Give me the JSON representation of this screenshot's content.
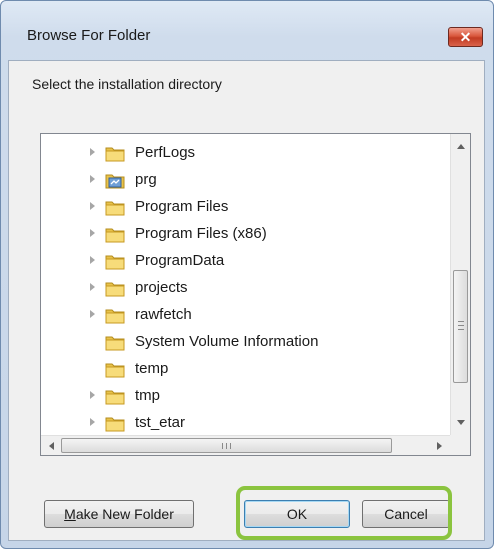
{
  "window": {
    "title": "Browse For Folder",
    "close_label": "✕"
  },
  "prompt": "Select the installation directory",
  "tree": {
    "items": [
      {
        "label": "PerfLogs",
        "icon": "folder-icon",
        "expander": true
      },
      {
        "label": "prg",
        "icon": "special-folder-icon",
        "expander": true
      },
      {
        "label": "Program Files",
        "icon": "folder-icon",
        "expander": true
      },
      {
        "label": "Program Files (x86)",
        "icon": "folder-icon",
        "expander": true
      },
      {
        "label": "ProgramData",
        "icon": "folder-icon",
        "expander": true
      },
      {
        "label": "projects",
        "icon": "folder-icon",
        "expander": true
      },
      {
        "label": "rawfetch",
        "icon": "folder-icon",
        "expander": true
      },
      {
        "label": "System Volume Information",
        "icon": "folder-icon",
        "expander": false
      },
      {
        "label": "temp",
        "icon": "folder-icon",
        "expander": false
      },
      {
        "label": "tmp",
        "icon": "folder-icon",
        "expander": true
      },
      {
        "label": "tst_etar",
        "icon": "folder-icon",
        "expander": true
      }
    ]
  },
  "buttons": {
    "make_new_folder": {
      "mnemonic": "M",
      "rest": "ake New Folder"
    },
    "ok": "OK",
    "cancel": "Cancel"
  },
  "colors": {
    "highlight": "#8bc43f",
    "close": "#c23b22"
  }
}
